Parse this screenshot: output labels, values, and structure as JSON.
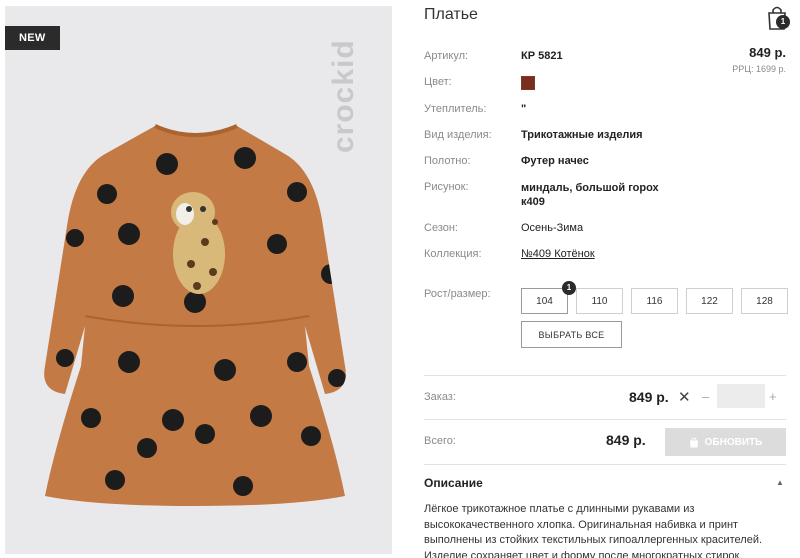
{
  "image": {
    "badge": "NEW",
    "brand": "crockid"
  },
  "product": {
    "title": "Платье",
    "cart_count": "1",
    "price": "849 р.",
    "rrp": "РРЦ: 1699 р."
  },
  "attributes": [
    {
      "label": "Артикул:",
      "value": "КР 5821"
    },
    {
      "label": "Цвет:",
      "value": ""
    },
    {
      "label": "Утеплитель:",
      "value": "\""
    },
    {
      "label": "Вид изделия:",
      "value": "Трикотажные изделия"
    },
    {
      "label": "Полотно:",
      "value": "Футер начес"
    },
    {
      "label": "Рисунок:",
      "value": "миндаль, большой горох к409"
    },
    {
      "label": "Сезон:",
      "value": "Осень-Зима"
    },
    {
      "label": "Коллекция:",
      "value": "№409 Котёнок"
    }
  ],
  "colors": {
    "swatch": "#7a2d1d",
    "dress": "#c47a45",
    "dots": "#1c1c1c"
  },
  "sizes": {
    "label": "Рост/размер:",
    "options": [
      "104",
      "110",
      "116",
      "122",
      "128"
    ],
    "selected_badge": "1",
    "select_all": "ВЫБРАТЬ ВСЕ"
  },
  "order": {
    "label": "Заказ:",
    "price": "849 р.",
    "remove": "✕",
    "minus": "–",
    "plus": "+",
    "qty_value": ""
  },
  "total": {
    "label": "Всего:",
    "price": "849 р.",
    "update": "ОБНОВИТЬ"
  },
  "description": {
    "heading": "Описание",
    "text": "Лёгкое трикотажное платье с длинными рукавами из высококачественного хлопка. Оригинальная набивка и принт выполнены из стойких текстильных гипоаллергенных красителей. Изделие сохраняет цвет и форму после многократных стирок."
  }
}
